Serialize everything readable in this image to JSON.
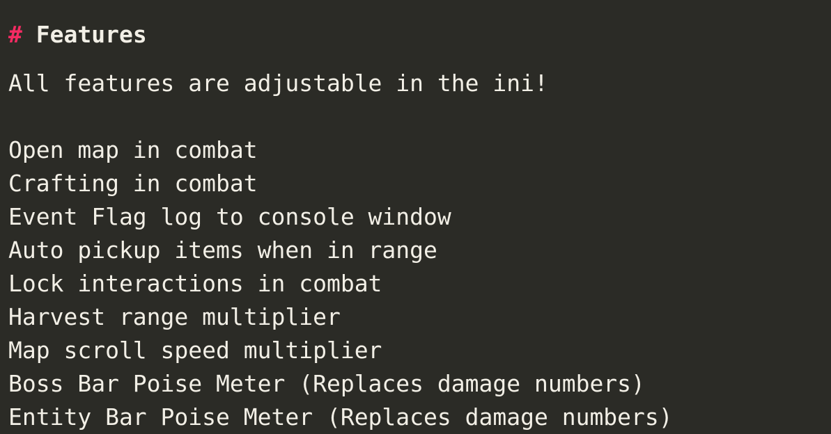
{
  "document": {
    "theme": {
      "background_color": "#2b2b26",
      "text_color": "#f2efe6",
      "heading_marker_color": "#f52b62"
    },
    "heading": {
      "marker": "#",
      "separator": " ",
      "text": "Features",
      "level": 1
    },
    "intro": {
      "text": "All features are adjustable in the ini!"
    },
    "features": [
      {
        "label": "Open map in combat"
      },
      {
        "label": "Crafting in combat"
      },
      {
        "label": "Event Flag log to console window"
      },
      {
        "label": "Auto pickup items when in range"
      },
      {
        "label": "Lock interactions in combat"
      },
      {
        "label": "Harvest range multiplier"
      },
      {
        "label": "Map scroll speed multiplier"
      },
      {
        "label": "Boss Bar Poise Meter (Replaces damage numbers)"
      },
      {
        "label": "Entity Bar Poise Meter (Replaces damage numbers)"
      }
    ]
  }
}
